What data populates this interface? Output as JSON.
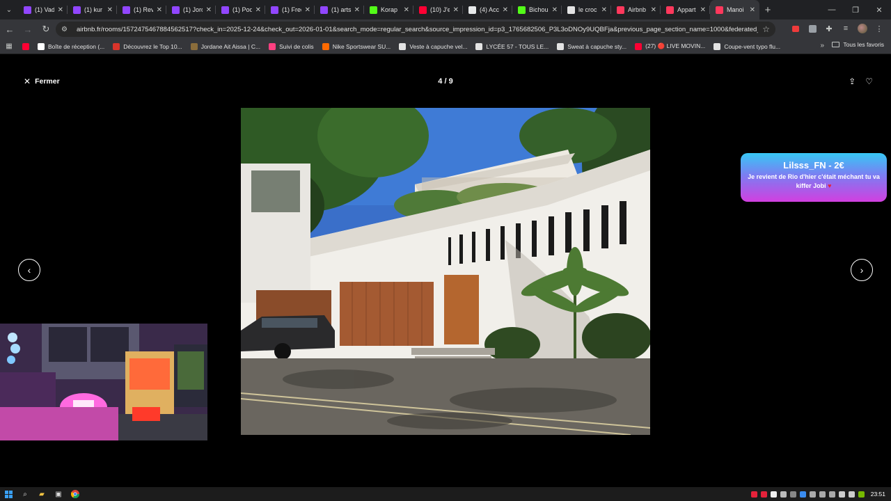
{
  "browser": {
    "tabs": [
      {
        "title": "(1) Vad",
        "favicon_color": "#9146ff",
        "active": false
      },
      {
        "title": "(1) kur",
        "favicon_color": "#9146ff",
        "active": false
      },
      {
        "title": "(1) Rev",
        "favicon_color": "#9146ff",
        "active": false
      },
      {
        "title": "(1) Jord",
        "favicon_color": "#9146ff",
        "active": false
      },
      {
        "title": "(1) Pod",
        "favicon_color": "#9146ff",
        "active": false
      },
      {
        "title": "(1) Fred",
        "favicon_color": "#9146ff",
        "active": false
      },
      {
        "title": "(1) arts",
        "favicon_color": "#9146ff",
        "active": false
      },
      {
        "title": "Korap",
        "favicon_color": "#53fc18",
        "active": false
      },
      {
        "title": "(10) J'e",
        "favicon_color": "#ff0033",
        "active": false
      },
      {
        "title": "(4) Acc",
        "favicon_color": "#e7e9ea",
        "active": false
      },
      {
        "title": "Bichou",
        "favicon_color": "#53fc18",
        "active": false
      },
      {
        "title": "le croc",
        "favicon_color": "#e3e3e3",
        "active": false
      },
      {
        "title": "Airbnb",
        "favicon_color": "#ff385c",
        "active": false
      },
      {
        "title": "Appart",
        "favicon_color": "#ff385c",
        "active": false
      },
      {
        "title": "Manoi",
        "favicon_color": "#ff385c",
        "active": true
      }
    ],
    "close_glyph": "✕",
    "new_tab_glyph": "+",
    "url": "airbnb.fr/rooms/1572475467884562517?check_in=2025-12-24&check_out=2026-01-01&search_mode=regular_search&source_impression_id=p3_1765682506_P3L3oDNOy9UQBFja&previous_page_section_name=1000&federated_search...",
    "bookmarks": [
      {
        "label": "",
        "icon_color": "#ff0033"
      },
      {
        "label": "Boîte de réception (...",
        "icon_color": "#ffffff"
      },
      {
        "label": "Découvrez le Top 10...",
        "icon_color": "#d9342b"
      },
      {
        "label": "Jordane Ait Aissa | C...",
        "icon_color": "#8a6d3b"
      },
      {
        "label": "Suivi de colis",
        "icon_color": "#ff4081"
      },
      {
        "label": "Nike Sportswear SU...",
        "icon_color": "#ff6a00"
      },
      {
        "label": "Veste à capuche vel...",
        "icon_color": "#e3e3e3"
      },
      {
        "label": "LYCÉE 57 - TOUS LE...",
        "icon_color": "#e3e3e3"
      },
      {
        "label": "Sweat à capuche sty...",
        "icon_color": "#e3e3e3"
      },
      {
        "label": "(27) 🔴 LIVE MOVIN...",
        "icon_color": "#ff0033"
      },
      {
        "label": "Coupe-vent typo flu...",
        "icon_color": "#e3e3e3"
      }
    ],
    "bookmarks_more": "»",
    "all_bookmarks": "Tous les favoris"
  },
  "viewer": {
    "close_label": "Fermer",
    "counter": "4 / 9",
    "prev_glyph": "‹",
    "next_glyph": "›"
  },
  "alert": {
    "title": "Lilsss_FN - 2€",
    "message": "Je revient de Rio d'hier c'était méchant tu va kiffer Jobi",
    "heart": "♥"
  },
  "taskbar": {
    "time": "23:51"
  }
}
